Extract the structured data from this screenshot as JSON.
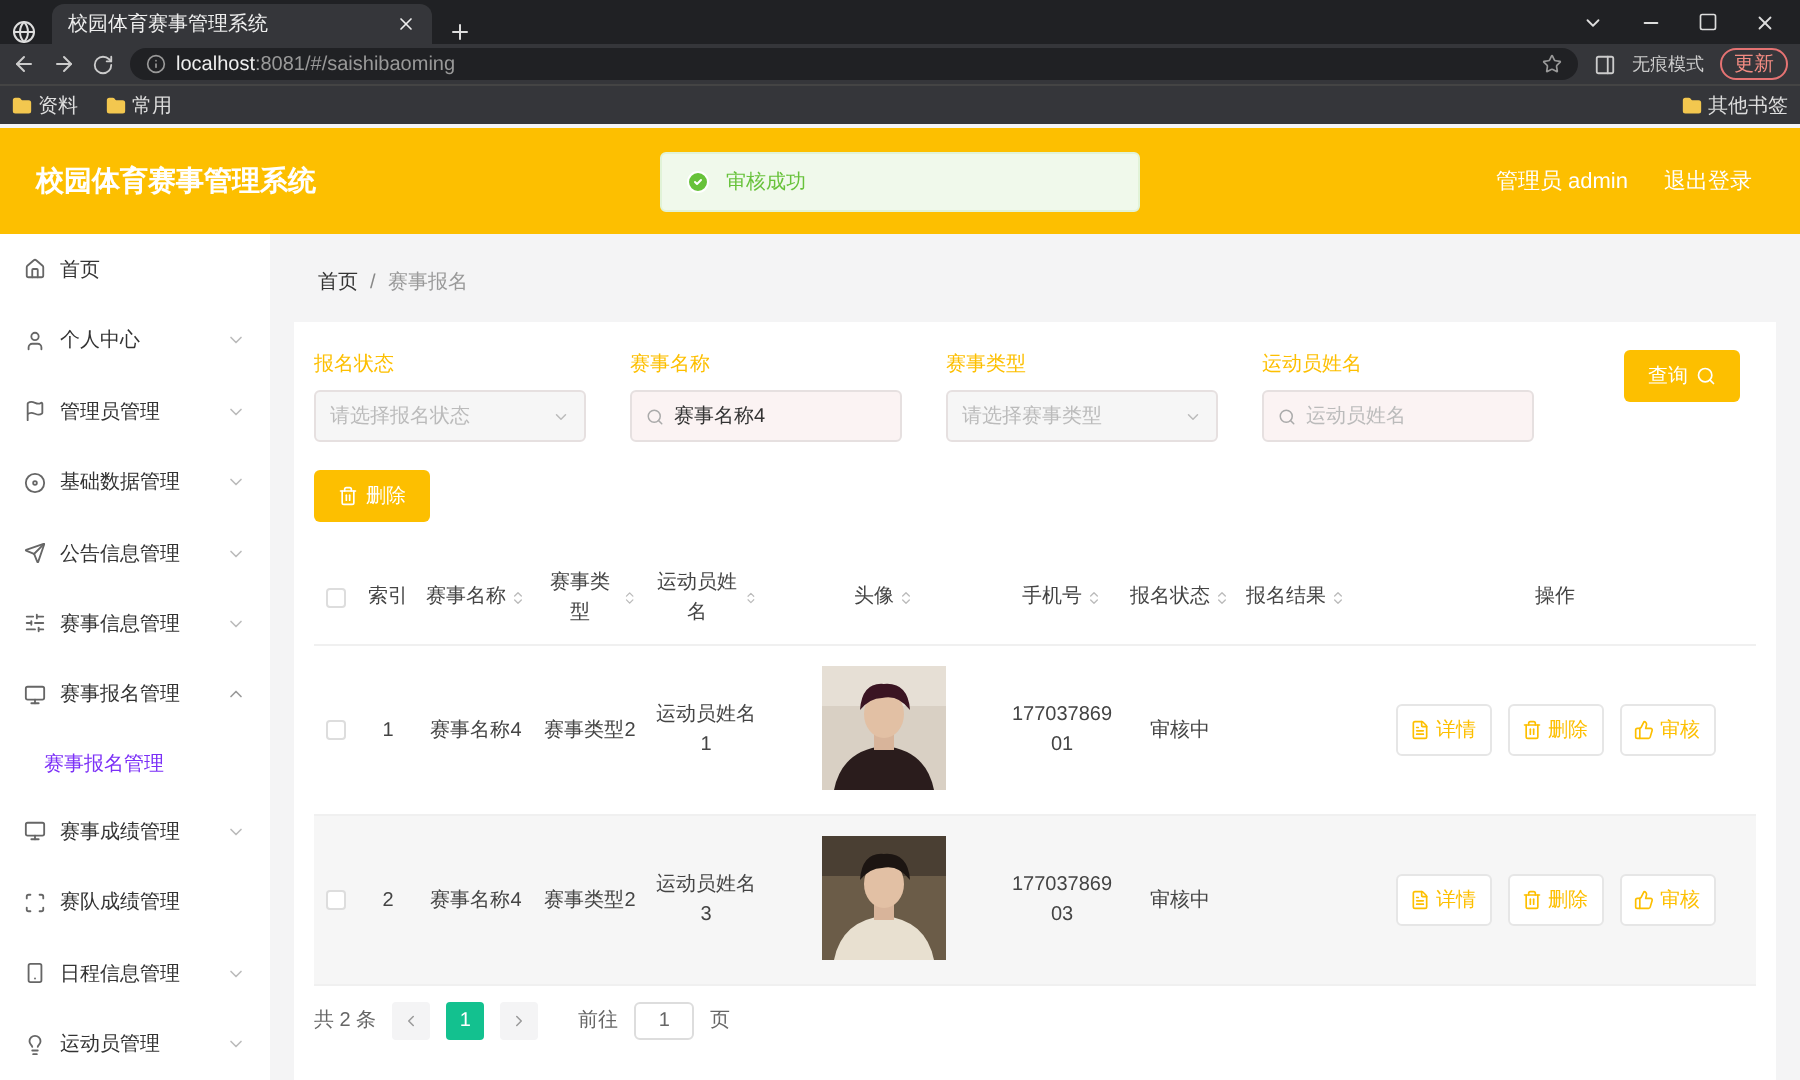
{
  "browser": {
    "tab_title": "校园体育赛事管理系统",
    "url_host": "localhost",
    "url_rest": ":8081/#/saishibaoming",
    "profile": "无痕模式",
    "update": "更新",
    "bookmarks": [
      "资料",
      "常用"
    ],
    "other_bookmarks": "其他书签"
  },
  "header": {
    "title": "校园体育赛事管理系统",
    "toast": "审核成功",
    "user": "管理员 admin",
    "logout": "退出登录"
  },
  "sidebar": [
    {
      "label": "首页"
    },
    {
      "label": "个人中心",
      "expanded": false
    },
    {
      "label": "管理员管理",
      "expanded": false
    },
    {
      "label": "基础数据管理",
      "expanded": false
    },
    {
      "label": "公告信息管理",
      "expanded": false
    },
    {
      "label": "赛事信息管理",
      "expanded": false
    },
    {
      "label": "赛事报名管理",
      "expanded": true,
      "children": [
        {
          "label": "赛事报名管理",
          "selected": true
        }
      ]
    },
    {
      "label": "赛事成绩管理",
      "expanded": false
    },
    {
      "label": "赛队成绩管理"
    },
    {
      "label": "日程信息管理",
      "expanded": false
    },
    {
      "label": "运动员管理",
      "expanded": false
    }
  ],
  "breadcrumb": [
    "首页",
    "赛事报名"
  ],
  "breadcrumb_separator": "/",
  "filters": [
    {
      "label": "报名状态",
      "kind": "select",
      "placeholder": "请选择报名状态"
    },
    {
      "label": "赛事名称",
      "kind": "search",
      "value": "赛事名称4"
    },
    {
      "label": "赛事类型",
      "kind": "select",
      "placeholder": "请选择赛事类型"
    },
    {
      "label": "运动员姓名",
      "kind": "search",
      "placeholder": "运动员姓名"
    }
  ],
  "query_button": "查询",
  "delete_button": "删除",
  "table": {
    "all_checked": false,
    "columns": [
      "索引",
      "赛事名称",
      "赛事类型",
      "运动员姓名",
      "头像",
      "手机号",
      "报名状态",
      "报名结果",
      "操作"
    ],
    "rows": [
      {
        "checked": false,
        "cells": [
          "1",
          "赛事名称4",
          "赛事类型2",
          "运动员姓名1",
          "",
          "17703786901",
          "审核中",
          ""
        ],
        "actions": [
          "详情",
          "删除",
          "审核"
        ]
      },
      {
        "checked": false,
        "cells": [
          "2",
          "赛事名称4",
          "赛事类型2",
          "运动员姓名3",
          "",
          "17703786903",
          "审核中",
          ""
        ],
        "actions": [
          "详情",
          "删除",
          "审核"
        ]
      }
    ]
  },
  "pagination": {
    "total": "共 2 条",
    "pages": [
      {
        "label": "1",
        "selected": true
      }
    ],
    "goto": "前往",
    "page_input": "1",
    "page_unit": "页"
  }
}
